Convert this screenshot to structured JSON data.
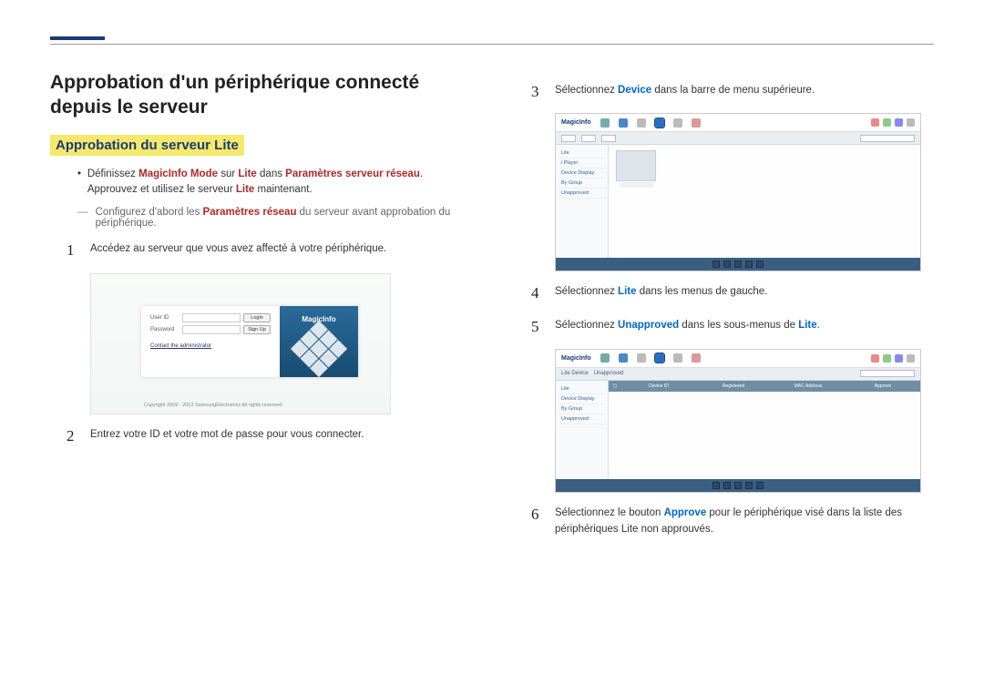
{
  "heading": "Approbation d'un périphérique connecté depuis le serveur",
  "subheading": "Approbation du serveur Lite",
  "bullet1_pre": "Définissez ",
  "bullet1_em1": "MagicInfo Mode",
  "bullet1_mid": " sur ",
  "bullet1_em2": "Lite",
  "bullet1_mid2": " dans ",
  "bullet1_em3": "Paramètres serveur réseau",
  "bullet1_post": ". Approuvez et utilisez le serveur ",
  "bullet1_em4": "Lite",
  "bullet1_end": " maintenant.",
  "dash_pre": "Configurez d'abord les ",
  "dash_em": "Paramètres réseau",
  "dash_post": " du serveur avant approbation du périphérique.",
  "steps": {
    "n1": "1",
    "t1": "Accédez au serveur que vous avez affecté à votre périphérique.",
    "n2": "2",
    "t2": "Entrez votre ID et votre mot de passe pour vous connecter.",
    "n3": "3",
    "t3_pre": "Sélectionnez ",
    "t3_em": "Device",
    "t3_post": " dans la barre de menu supérieure.",
    "n4": "4",
    "t4_pre": "Sélectionnez ",
    "t4_em": "Lite",
    "t4_post": " dans les menus de gauche.",
    "n5": "5",
    "t5_pre": "Sélectionnez ",
    "t5_em": "Unapproved",
    "t5_post": " dans les sous-menus de ",
    "t5_em2": "Lite",
    "t5_end": ".",
    "n6": "6",
    "t6_pre": "Sélectionnez le bouton ",
    "t6_em": "Approve",
    "t6_post": " pour le périphérique visé dans la liste des périphériques Lite non approuvés."
  },
  "login": {
    "userid": "User ID",
    "password": "Password",
    "login_btn": "Login",
    "signup_btn": "Sign Up",
    "contact": "Contact the administrator",
    "brand": "MagicInfo",
    "copyright": "Copyright 2009 - 2013 SamsungElectronics All rights reserved."
  },
  "app": {
    "brand": "MagicInfo",
    "side1": [
      "Lite",
      "i Player",
      "Device Display",
      "By Group",
      "Unapproved"
    ],
    "side2": [
      "Lite",
      "Device Display",
      "By Group",
      "Unapproved"
    ],
    "cols": {
      "c0": "",
      "c1": "Device ID",
      "c2": "Registered",
      "c3": "MAC Address",
      "c4": "Approve"
    },
    "tabs": {
      "lite": "Lite Device",
      "unapp": "Unapproved"
    }
  }
}
